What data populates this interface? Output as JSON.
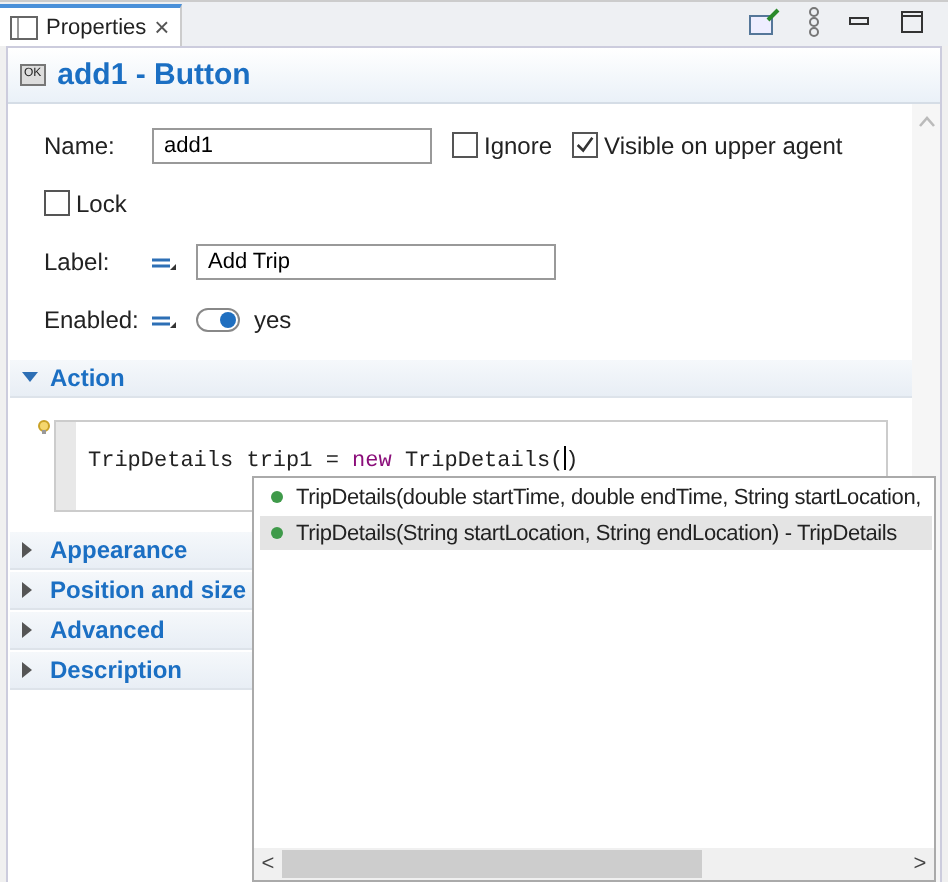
{
  "tab": {
    "label": "Properties",
    "close": "×",
    "selected": true
  },
  "header": {
    "title": "add1 - Button",
    "icon_text": "OK"
  },
  "name_field": {
    "label": "Name:",
    "value": "add1"
  },
  "checkboxes": [
    {
      "label": "Ignore",
      "checked": false
    },
    {
      "label": "Visible on upper agent",
      "checked": true
    }
  ],
  "lock": {
    "label": "Lock",
    "checked": false
  },
  "label_field": {
    "label": "Label:",
    "value": "Add Trip"
  },
  "enabled": {
    "label": "Enabled:",
    "on": true,
    "text": "yes"
  },
  "action": {
    "title": "Action",
    "expanded": true,
    "code": [
      {
        "kind": "plain",
        "text": "TripDetails trip1 = "
      },
      {
        "kind": "keyword",
        "text": "new"
      },
      {
        "kind": "plain",
        "text": " TripDetails("
      },
      {
        "kind": "caret"
      },
      {
        "kind": "plain",
        "text": ")"
      }
    ]
  },
  "sections": [
    {
      "title": "Appearance",
      "expanded": false
    },
    {
      "title": "Position and size",
      "expanded": false
    },
    {
      "title": "Advanced",
      "expanded": false
    },
    {
      "title": "Description",
      "expanded": false
    }
  ],
  "completions": [
    {
      "text": "TripDetails(double startTime, double endTime, String startLocation,",
      "selected": false
    },
    {
      "text": "TripDetails(String startLocation, String endLocation) - TripDetails",
      "selected": true
    }
  ],
  "popup_scroll": {
    "left": "<",
    "right": ">"
  }
}
